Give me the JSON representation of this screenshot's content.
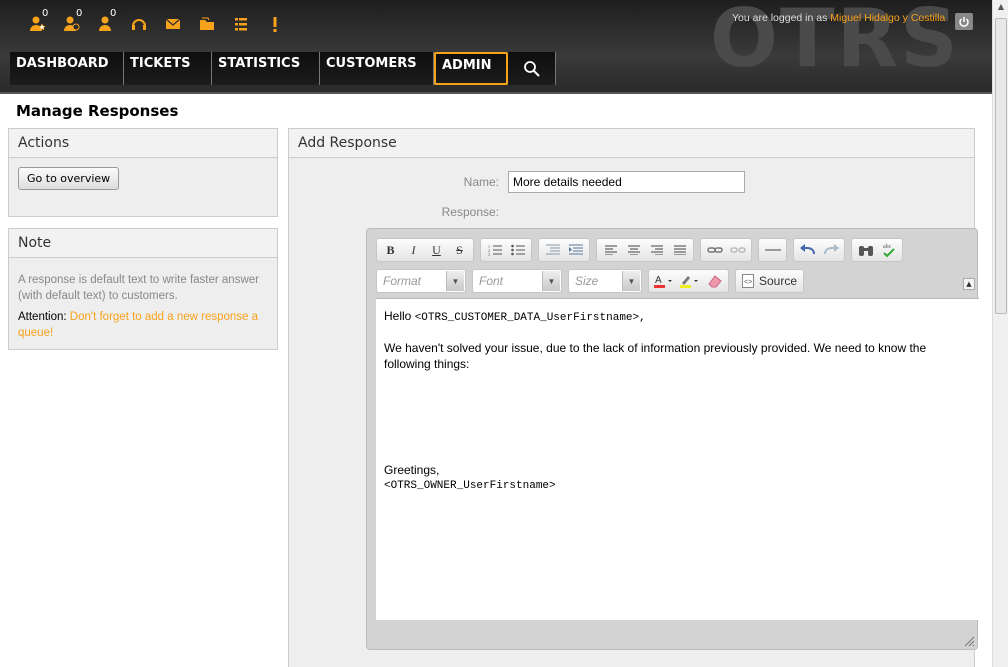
{
  "header": {
    "watermark": "OTRS",
    "toolbar": [
      {
        "icon": "user-star-icon",
        "count": "0"
      },
      {
        "icon": "user-alert-icon",
        "count": "0"
      },
      {
        "icon": "user-icon",
        "count": "0"
      },
      {
        "icon": "headset-icon",
        "count": ""
      },
      {
        "icon": "envelope-icon",
        "count": ""
      },
      {
        "icon": "folder-icon",
        "count": ""
      },
      {
        "icon": "list-icon",
        "count": ""
      },
      {
        "icon": "exclamation-icon",
        "count": ""
      }
    ],
    "login_prefix": "You are logged in as",
    "login_user": "Miguel Hidalgo y Costilla",
    "accent": "#f7a21b"
  },
  "nav": {
    "items": [
      {
        "label": "DASHBOARD",
        "active": false
      },
      {
        "label": "TICKETS",
        "active": false
      },
      {
        "label": "STATISTICS",
        "active": false
      },
      {
        "label": "CUSTOMERS",
        "active": false
      },
      {
        "label": "ADMIN",
        "active": true
      }
    ],
    "search_icon": "search-icon"
  },
  "page": {
    "title": "Manage Responses"
  },
  "sidebar": {
    "actions": {
      "title": "Actions",
      "button": "Go to overview"
    },
    "note": {
      "title": "Note",
      "text": "A response is default text to write faster answer (with default text) to customers.",
      "attention_label": "Attention:",
      "attention_link": "Don't forget to add a new response a queue!"
    }
  },
  "main": {
    "title": "Add Response",
    "name_label": "Name:",
    "name_value": "More details needed",
    "response_label": "Response:",
    "editor": {
      "format_placeholder": "Format",
      "font_placeholder": "Font",
      "size_placeholder": "Size",
      "source_label": "Source",
      "lines": [
        {
          "plain": "Hello ",
          "mono": "<OTRS_CUSTOMER_DATA_UserFirstname>,"
        },
        {
          "plain": "We haven't solved your issue, due to the lack of information previously provided. We need to know the following things:"
        },
        {
          "plain": "Greetings,"
        },
        {
          "mono": "<OTRS_OWNER_UserFirstname>"
        }
      ]
    }
  }
}
